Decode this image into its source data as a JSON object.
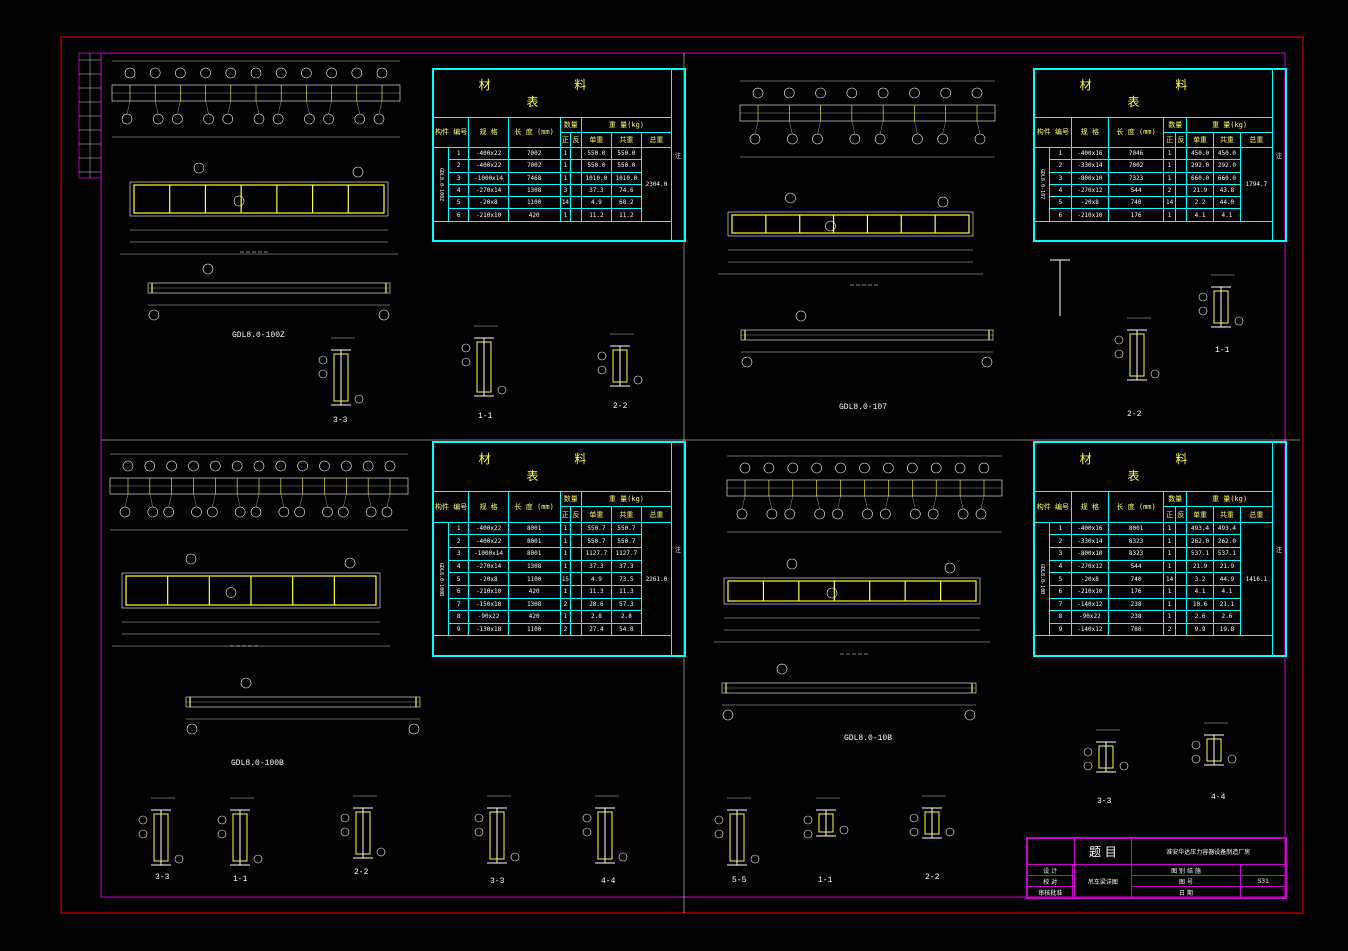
{
  "colors": {
    "frame": "#cc0000",
    "border": "#cc00cc",
    "table": "#00ffff",
    "steel": "#ffff33",
    "line": "#ffffff"
  },
  "table_title": "材 料 表",
  "col_headers": {
    "part": "构件 编号",
    "num": "零件 编号",
    "spec": "规 格",
    "length": "长 度 (mm)",
    "qty": "数量",
    "qty_pos": "正",
    "qty_neg": "反",
    "weight": "重 量(kg)",
    "unit": "单重",
    "sum": "共重",
    "total": "总重",
    "note": "注"
  },
  "tables": [
    {
      "member": "GDL8.0-100Z",
      "total": "2304.0",
      "rows": [
        [
          "1",
          "-400x22",
          "7002",
          "1",
          "550.0",
          "550.0"
        ],
        [
          "2",
          "-400x22",
          "7002",
          "1",
          "550.0",
          "550.0"
        ],
        [
          "3",
          "-1000x14",
          "7468",
          "1",
          "1010.0",
          "1010.0"
        ],
        [
          "4",
          "-270x14",
          "1308",
          "3",
          "37.3",
          "74.6"
        ],
        [
          "5",
          "-20x8",
          "1100",
          "14",
          "4.9",
          "68.2"
        ],
        [
          "6",
          "-210x10",
          "420",
          "1",
          "11.2",
          "11.2"
        ]
      ]
    },
    {
      "member": "GDL8.0-107",
      "total": "1794.7",
      "rows": [
        [
          "1",
          "-400x16",
          "7046",
          "1",
          "450.0",
          "450.0"
        ],
        [
          "2",
          "-330x14",
          "7002",
          "1",
          "292.0",
          "292.0"
        ],
        [
          "3",
          "-800x10",
          "7323",
          "1",
          "660.0",
          "660.0"
        ],
        [
          "4",
          "-270x12",
          "544",
          "2",
          "21.9",
          "43.8"
        ],
        [
          "5",
          "-20x8",
          "740",
          "14",
          "2.2",
          "44.0"
        ],
        [
          "6",
          "-210x10",
          "176",
          "1",
          "4.1",
          "4.1"
        ]
      ]
    },
    {
      "member": "GDL8.0-100B",
      "total": "2261.0",
      "rows": [
        [
          "1",
          "-400x22",
          "8001",
          "1",
          "550.7",
          "550.7"
        ],
        [
          "2",
          "-400x22",
          "8001",
          "1",
          "550.7",
          "550.7"
        ],
        [
          "3",
          "-1000x14",
          "8001",
          "1",
          "1127.7",
          "1127.7"
        ],
        [
          "4",
          "-270x14",
          "1308",
          "1",
          "37.3",
          "37.3"
        ],
        [
          "5",
          "-20x8",
          "1100",
          "15",
          "4.9",
          "73.5"
        ],
        [
          "6",
          "-210x10",
          "420",
          "1",
          "11.3",
          "11.3"
        ],
        [
          "7",
          "-150x18",
          "1308",
          "2",
          "28.6",
          "57.3"
        ],
        [
          "8",
          "-90x22",
          "420",
          "1",
          "2.8",
          "2.8"
        ],
        [
          "9",
          "-130x18",
          "1100",
          "2",
          "27.4",
          "54.8"
        ]
      ]
    },
    {
      "member": "GDL8.0-10B",
      "total": "1416.1",
      "rows": [
        [
          "1",
          "-400x16",
          "8001",
          "1",
          "493.4",
          "493.4"
        ],
        [
          "2",
          "-330x14",
          "8323",
          "1",
          "262.0",
          "262.0"
        ],
        [
          "3",
          "-800x10",
          "8323",
          "1",
          "537.1",
          "537.1"
        ],
        [
          "4",
          "-270x12",
          "544",
          "1",
          "21.9",
          "21.9"
        ],
        [
          "5",
          "-20x8",
          "740",
          "14",
          "3.2",
          "44.9"
        ],
        [
          "6",
          "-210x10",
          "176",
          "1",
          "4.1",
          "4.1"
        ],
        [
          "7",
          "-140x12",
          "238",
          "1",
          "10.6",
          "21.1"
        ],
        [
          "8",
          "-90x22",
          "238",
          "1",
          "2.6",
          "2.6"
        ],
        [
          "9",
          "-140x12",
          "780",
          "2",
          "9.9",
          "19.8"
        ]
      ]
    }
  ],
  "drawings": {
    "q1_name": "GDL8.0-100Z",
    "q2_name": "GDL8.0-107",
    "q3_name": "GDL8.0-100B",
    "q4_name": "GDL8.0-10B",
    "sec_1": "1-1",
    "sec_2": "2-2",
    "sec_3": "3-3",
    "sec_4": "4-4",
    "sec_5": "5-5"
  },
  "title_block": {
    "label": "题 目",
    "project": "淮安华达压力容器设备制造厂房",
    "drawing_name": "吊车梁详图",
    "r1": "设 计",
    "r2": "校 对",
    "r3": "审核批准",
    "f1": "图 别 结 施",
    "f2": "图 号",
    "f3": "日 期",
    "sheet_no": "S31"
  }
}
